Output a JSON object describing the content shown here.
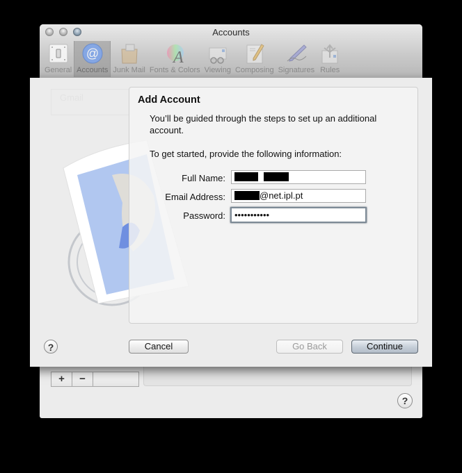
{
  "window": {
    "title": "Accounts",
    "traffic_lights": [
      "close",
      "minimize",
      "zoom"
    ]
  },
  "toolbar": {
    "items": [
      {
        "label": "General",
        "icon": "light-switch-icon",
        "active": false
      },
      {
        "label": "Accounts",
        "icon": "at-sign-icon",
        "active": true
      },
      {
        "label": "Junk Mail",
        "icon": "junk-bag-icon",
        "active": false
      },
      {
        "label": "Fonts & Colors",
        "icon": "font-color-wheel-icon",
        "active": false
      },
      {
        "label": "Viewing",
        "icon": "glasses-envelope-icon",
        "active": false
      },
      {
        "label": "Composing",
        "icon": "pencil-paper-icon",
        "active": false
      },
      {
        "label": "Signatures",
        "icon": "fountain-pen-icon",
        "active": false
      },
      {
        "label": "Rules",
        "icon": "arrows-envelope-icon",
        "active": false
      }
    ]
  },
  "background": {
    "account_entry": "Gmail",
    "add_symbol": "+",
    "remove_symbol": "−",
    "help_symbol": "?"
  },
  "sheet": {
    "heading": "Add Account",
    "intro": "You’ll be guided through the steps to set up an additional account.",
    "instruction": "To get started, provide the following information:",
    "fields": {
      "full_name": {
        "label": "Full Name:",
        "value_redacted": true,
        "value": ""
      },
      "email": {
        "label": "Email Address:",
        "value_visible_suffix": "@net.ipl.pt"
      },
      "password": {
        "label": "Password:",
        "value": "•••••••••••"
      }
    },
    "buttons": {
      "help": "?",
      "cancel": "Cancel",
      "go_back": "Go Back",
      "continue": "Continue"
    },
    "go_back_enabled": false,
    "default_button": "continue",
    "focused_field": "password"
  },
  "colors": {
    "accounts_icon": "#7ea6ee",
    "continue_button": "#c5ced8",
    "stamp_blue": "#a9c1ee"
  }
}
